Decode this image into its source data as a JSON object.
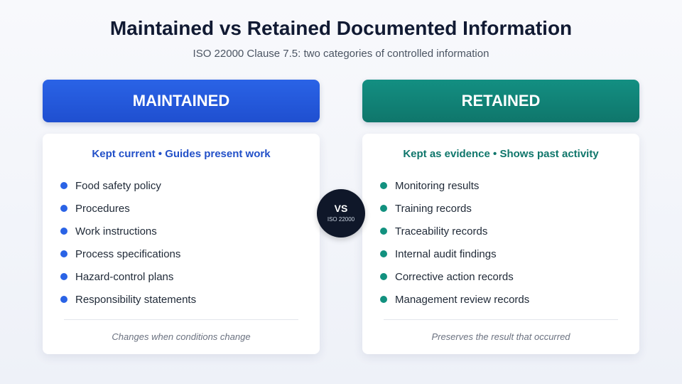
{
  "title": "Maintained vs Retained Documented Information",
  "subtitle": "ISO 22000 Clause 7.5: two categories of controlled information",
  "left": {
    "header": "MAINTAINED",
    "tagline": "Kept current • Guides present work",
    "items": [
      "Food safety policy",
      "Procedures",
      "Work instructions",
      "Process specifications",
      "Hazard-control plans",
      "Responsibility statements"
    ],
    "footnote": "Changes when conditions change",
    "accent_color": "#2a63e6"
  },
  "right": {
    "header": "RETAINED",
    "tagline": "Kept as evidence • Shows past activity",
    "items": [
      "Monitoring results",
      "Training records",
      "Traceability records",
      "Internal audit findings",
      "Corrective action records",
      "Management review records"
    ],
    "footnote": "Preserves the result that occurred",
    "accent_color": "#0f766b"
  },
  "badge": {
    "main": "VS",
    "sub": "ISO 22000"
  }
}
